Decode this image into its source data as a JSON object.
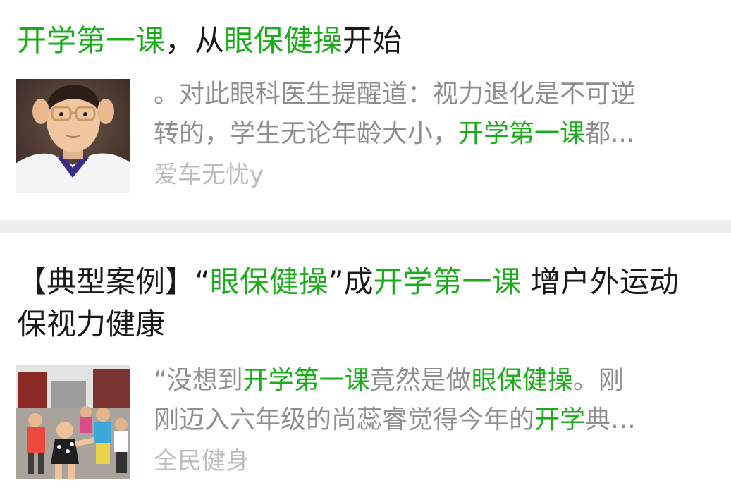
{
  "results": [
    {
      "title_parts": [
        {
          "text": "开学第一课",
          "hl": true
        },
        {
          "text": "，从",
          "hl": false
        },
        {
          "text": "眼保健操",
          "hl": true
        },
        {
          "text": "开始",
          "hl": false
        }
      ],
      "snippet_line1": [
        {
          "text": "。对此眼科医生提醒道：视力退化是不可逆",
          "hl": false
        }
      ],
      "snippet_line2": [
        {
          "text": "转的，学生无论年龄大小，",
          "hl": false
        },
        {
          "text": "开学第一课",
          "hl": true
        },
        {
          "text": "都...",
          "hl": false
        }
      ],
      "source": "爱车无忧y",
      "thumbnail_icon": "boy-adjusting-glasses-photo"
    },
    {
      "title_parts": [
        {
          "text": "【典型案例】“",
          "hl": false
        },
        {
          "text": "眼保健操",
          "hl": true
        },
        {
          "text": "”成",
          "hl": false
        },
        {
          "text": "开学第一课",
          "hl": true
        },
        {
          "text": " 增户外运动保视力健康",
          "hl": false
        }
      ],
      "snippet_line1": [
        {
          "text": "“没想到",
          "hl": false
        },
        {
          "text": "开学第一课",
          "hl": true
        },
        {
          "text": "竟然是做",
          "hl": false
        },
        {
          "text": "眼保健操",
          "hl": true
        },
        {
          "text": "。刚",
          "hl": false
        }
      ],
      "snippet_line2": [
        {
          "text": "刚迈入六年级的尚蕊睿觉得今年的",
          "hl": false
        },
        {
          "text": "开学",
          "hl": true
        },
        {
          "text": "典…",
          "hl": false
        }
      ],
      "source": "全民健身",
      "thumbnail_icon": "children-exercising-outdoors-photo"
    }
  ],
  "colors": {
    "highlight": "#1aad19",
    "title": "#1a1a1a",
    "snippet": "#8e8e8e",
    "source": "#bdbdbd",
    "separator": "#ededed"
  }
}
